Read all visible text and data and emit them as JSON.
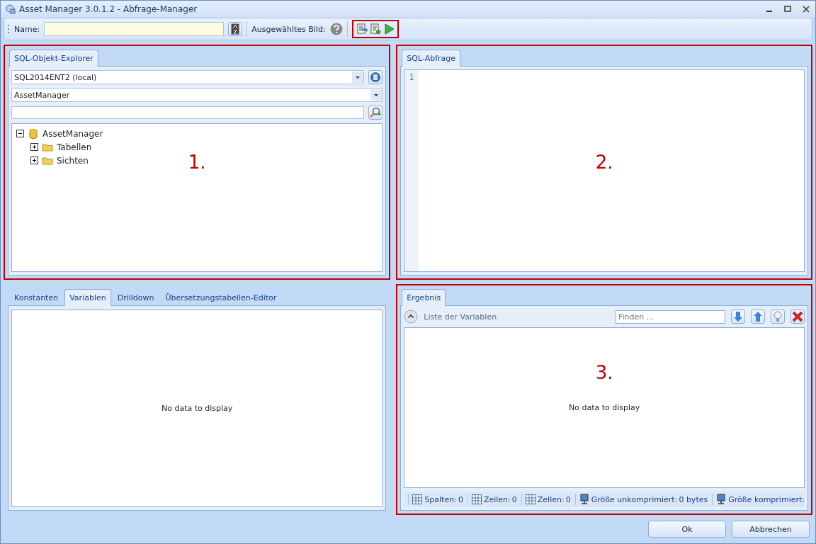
{
  "window": {
    "title": "Asset Manager 3.0.1.2 - Abfrage-Manager"
  },
  "toolbar": {
    "name_label": "Name:",
    "image_label": "Ausgewähltes Bild:"
  },
  "explorer": {
    "callout": "1.",
    "tabs": [
      {
        "label": "SQL-Objekt-Explorer",
        "selected": true
      }
    ],
    "server": "SQL2014ENT2 (local)",
    "database": "AssetManager",
    "tree": [
      {
        "label": "AssetManager",
        "kind": "database",
        "expanded": true,
        "children": [
          {
            "label": "Tabellen",
            "kind": "folder",
            "expanded": false
          },
          {
            "label": "Sichten",
            "kind": "folder",
            "expanded": false
          }
        ]
      }
    ]
  },
  "query": {
    "callout": "2.",
    "tabs": [
      {
        "label": "SQL-Abfrage",
        "selected": true
      }
    ],
    "line_numbers": [
      "1"
    ]
  },
  "variables": {
    "tabs": [
      {
        "label": "Konstanten",
        "selected": false
      },
      {
        "label": "Variablen",
        "selected": true
      },
      {
        "label": "Drilldown",
        "selected": false
      },
      {
        "label": "Übersetzungstabellen-Editor",
        "selected": false
      }
    ],
    "empty_text": "No data to display"
  },
  "result": {
    "callout": "3.",
    "tabs": [
      {
        "label": "Ergebnis",
        "selected": true
      }
    ],
    "group_title": "Liste der Variablen",
    "search_placeholder": "Finden ...",
    "empty_text": "No data to display",
    "status": [
      {
        "kind": "columns",
        "label": "Spalten:",
        "value": "0"
      },
      {
        "kind": "rows",
        "label": "Zeilen:",
        "value": "0"
      },
      {
        "kind": "cells",
        "label": "Zellen:",
        "value": "0"
      },
      {
        "kind": "uncompressed",
        "label": "Größe unkomprimiert:",
        "value": "0 bytes"
      },
      {
        "kind": "compressed",
        "label": "Größe komprimiert:"
      }
    ]
  },
  "buttons": [
    "Ok",
    "Abbrechen"
  ]
}
